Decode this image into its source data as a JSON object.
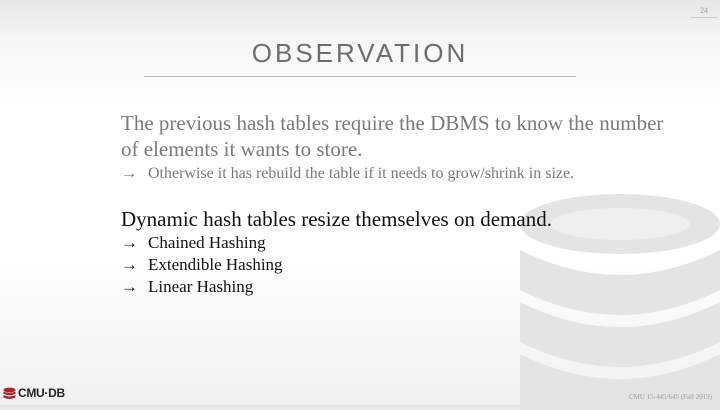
{
  "slide_number": "24",
  "title": "OBSERVATION",
  "point1": {
    "text": "The previous hash tables require the DBMS to know the number of elements it wants to store.",
    "sub": [
      {
        "arrow": "→",
        "text": "Otherwise it has rebuild the table if it needs to grow/shrink in size."
      }
    ]
  },
  "point2": {
    "text": "Dynamic hash tables resize themselves on demand.",
    "sub": [
      {
        "arrow": "→",
        "text": "Chained Hashing"
      },
      {
        "arrow": "→",
        "text": "Extendible Hashing"
      },
      {
        "arrow": "→",
        "text": "Linear Hashing"
      }
    ]
  },
  "logo": {
    "text": "CMU·DB",
    "color": "#b22222"
  },
  "footer": "CMU 15-445/645 (Fall 2019)"
}
